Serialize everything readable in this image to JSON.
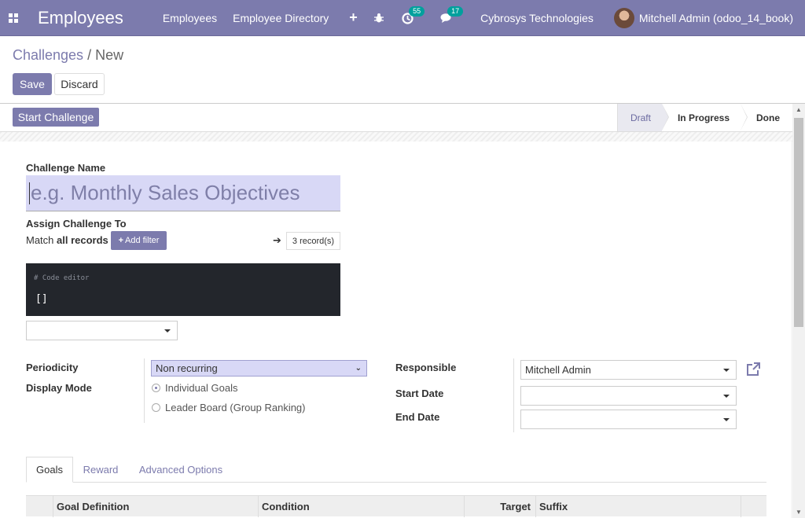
{
  "navbar": {
    "app_title": "Employees",
    "links": [
      "Employees",
      "Employee Directory"
    ],
    "plus": "+",
    "activity_count": "55",
    "message_count": "17",
    "company": "Cybrosys Technologies",
    "user": "Mitchell Admin (odoo_14_book)"
  },
  "breadcrumb": {
    "parent": "Challenges",
    "separator": " / ",
    "current": "New"
  },
  "actions": {
    "save": "Save",
    "discard": "Discard"
  },
  "statusbar": {
    "start_button": "Start Challenge",
    "stages": [
      {
        "label": "Draft",
        "active": true
      },
      {
        "label": "In Progress",
        "active": false
      },
      {
        "label": "Done",
        "active": false
      }
    ]
  },
  "form": {
    "challenge_name_label": "Challenge Name",
    "challenge_name_placeholder": "e.g. Monthly Sales Objectives",
    "assign_label": "Assign Challenge To",
    "match_prefix": "Match",
    "match_bold": "all records",
    "add_filter": "Add filter",
    "records": "3 record(s)",
    "code_comment": "# Code editor",
    "code_value": "[]",
    "periodicity_label": "Periodicity",
    "periodicity_value": "Non recurring",
    "display_mode_label": "Display Mode",
    "display_modes": [
      {
        "label": "Individual Goals",
        "checked": true
      },
      {
        "label": "Leader Board (Group Ranking)",
        "checked": false
      }
    ],
    "responsible_label": "Responsible",
    "responsible_value": "Mitchell Admin",
    "start_date_label": "Start Date",
    "end_date_label": "End Date"
  },
  "tabs": [
    "Goals",
    "Reward",
    "Advanced Options"
  ],
  "goals_table": {
    "columns": [
      "Goal Definition",
      "Condition",
      "Target",
      "Suffix"
    ]
  },
  "colors": {
    "primary": "#7c7bad",
    "badge": "#00a09d",
    "input_highlight": "#d8d8f6"
  }
}
